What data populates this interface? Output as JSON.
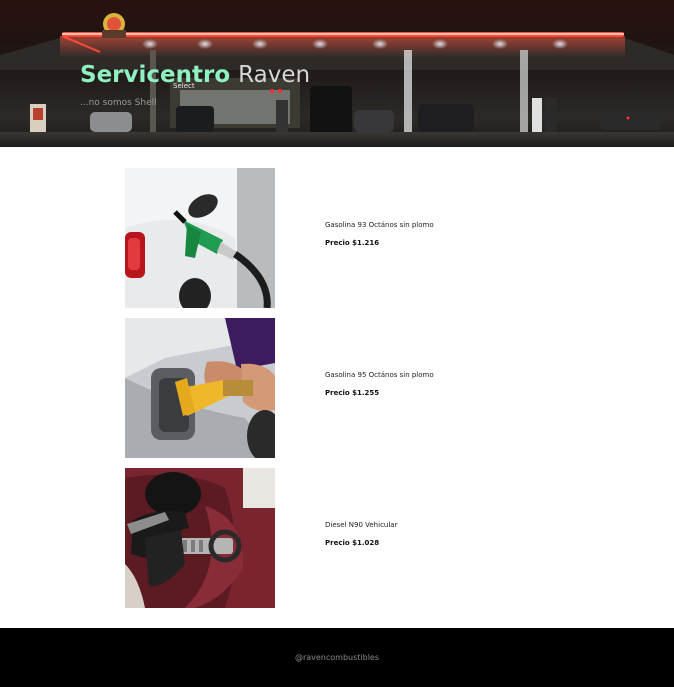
{
  "header": {
    "brand_part1": "Servicentro",
    "brand_part2": "Raven",
    "tagline": "...no somos Shell",
    "sign_text": "Select"
  },
  "products": [
    {
      "name": "Gasolina 93 Octános sin plomo",
      "price": "Precio $1.216"
    },
    {
      "name": "Gasolina 95 Octános sin plomo",
      "price": "Precio $1.255"
    },
    {
      "name": "Diesel N90 Vehicular",
      "price": "Precio $1.028"
    }
  ],
  "footer": {
    "social_handle": "@ravencombustibles"
  },
  "colors": {
    "brand_accent": "#8ff0c0",
    "canopy_neon": "#ff4a3a",
    "footer_bg": "#000000"
  }
}
